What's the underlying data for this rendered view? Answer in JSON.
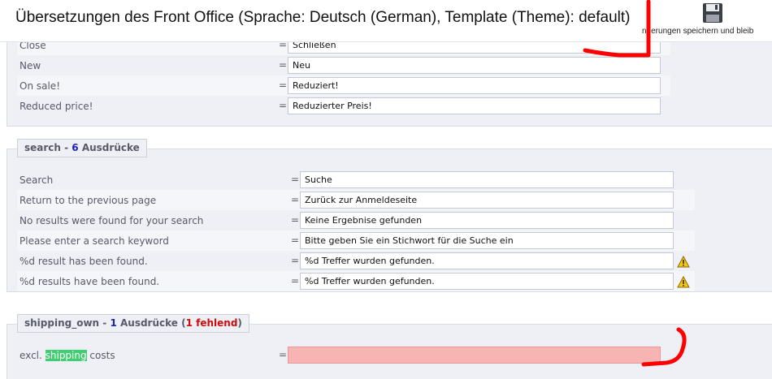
{
  "header": {
    "title": "Übersetzungen des Front Office (Sprache: Deutsch (German), Template (Theme): default)",
    "save_label": "nderungen speichern und bleib"
  },
  "section_product_list": {
    "rows": [
      {
        "label": "Close",
        "value": "Schließen"
      },
      {
        "label": "New",
        "value": "Neu"
      },
      {
        "label": "On sale!",
        "value": "Reduziert!"
      },
      {
        "label": "Reduced price!",
        "value": "Reduzierter Preis!"
      }
    ]
  },
  "section_search": {
    "legend_name": "search",
    "legend_sep": " - ",
    "legend_count": "6",
    "legend_suffix": " Ausdrücke",
    "rows": [
      {
        "label": "Search",
        "value": "Suche"
      },
      {
        "label": "Return to the previous page",
        "value": "Zurück zur Anmeldeseite"
      },
      {
        "label": "No results were found for your search",
        "value": "Keine Ergebnise gefunden"
      },
      {
        "label": "Please enter a search keyword",
        "value": "Bitte geben Sie ein Stichwort für die Suche ein"
      },
      {
        "label": "%d result has been found.",
        "value": "%d Treffer wurden gefunden."
      },
      {
        "label": "%d results have been found.",
        "value": "%d Treffer wurden gefunden."
      }
    ]
  },
  "section_shipping": {
    "legend_name": "shipping_own",
    "legend_sep": " - ",
    "legend_count": "1",
    "legend_suffix": " Ausdrücke (",
    "legend_missing_count": "1",
    "legend_missing_label": " fehlend",
    "legend_close": ")",
    "row_label_before": "excl. ",
    "row_label_highlight": "shipping",
    "row_label_after": " costs",
    "row_value": ""
  },
  "equals": "=",
  "icons": {
    "save": "floppy-disk-icon",
    "warning": "warning-triangle-icon"
  },
  "colors": {
    "panel_bg": "#eef0f5",
    "missing_field": "#f8b3b3",
    "highlight": "#3fce71",
    "count_blue": "#1b23b6",
    "missing_red": "#d10a0a",
    "marker_red": "#ff0000"
  }
}
